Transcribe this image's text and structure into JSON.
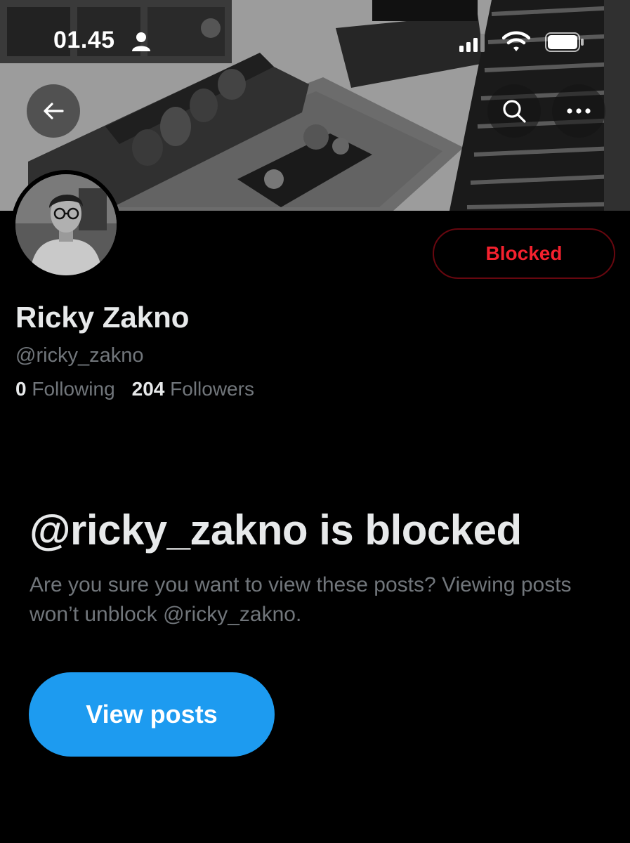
{
  "status_bar": {
    "time": "01.45",
    "person_icon": "person-icon",
    "signal_icon": "signal-icon",
    "wifi_icon": "wifi-icon",
    "battery_icon": "battery-icon"
  },
  "header": {
    "back_icon": "arrow-left-icon",
    "search_icon": "search-icon",
    "more_icon": "more-horizontal-icon"
  },
  "profile": {
    "display_name": "Ricky Zakno",
    "handle": "@ricky_zakno",
    "following_count": "0",
    "following_label": "Following",
    "followers_count": "204",
    "followers_label": "Followers",
    "blocked_button_label": "Blocked"
  },
  "blocked_notice": {
    "title": "@ricky_zakno is blocked",
    "description": "Are you sure you want to view these posts? Viewing posts won’t unblock @ricky_zakno.",
    "view_button_label": "View posts"
  },
  "colors": {
    "background": "#000000",
    "accent_blue": "#1d9bf0",
    "blocked_red": "#f4212e",
    "text_primary": "#e7e9ea",
    "text_secondary": "#71767b"
  }
}
